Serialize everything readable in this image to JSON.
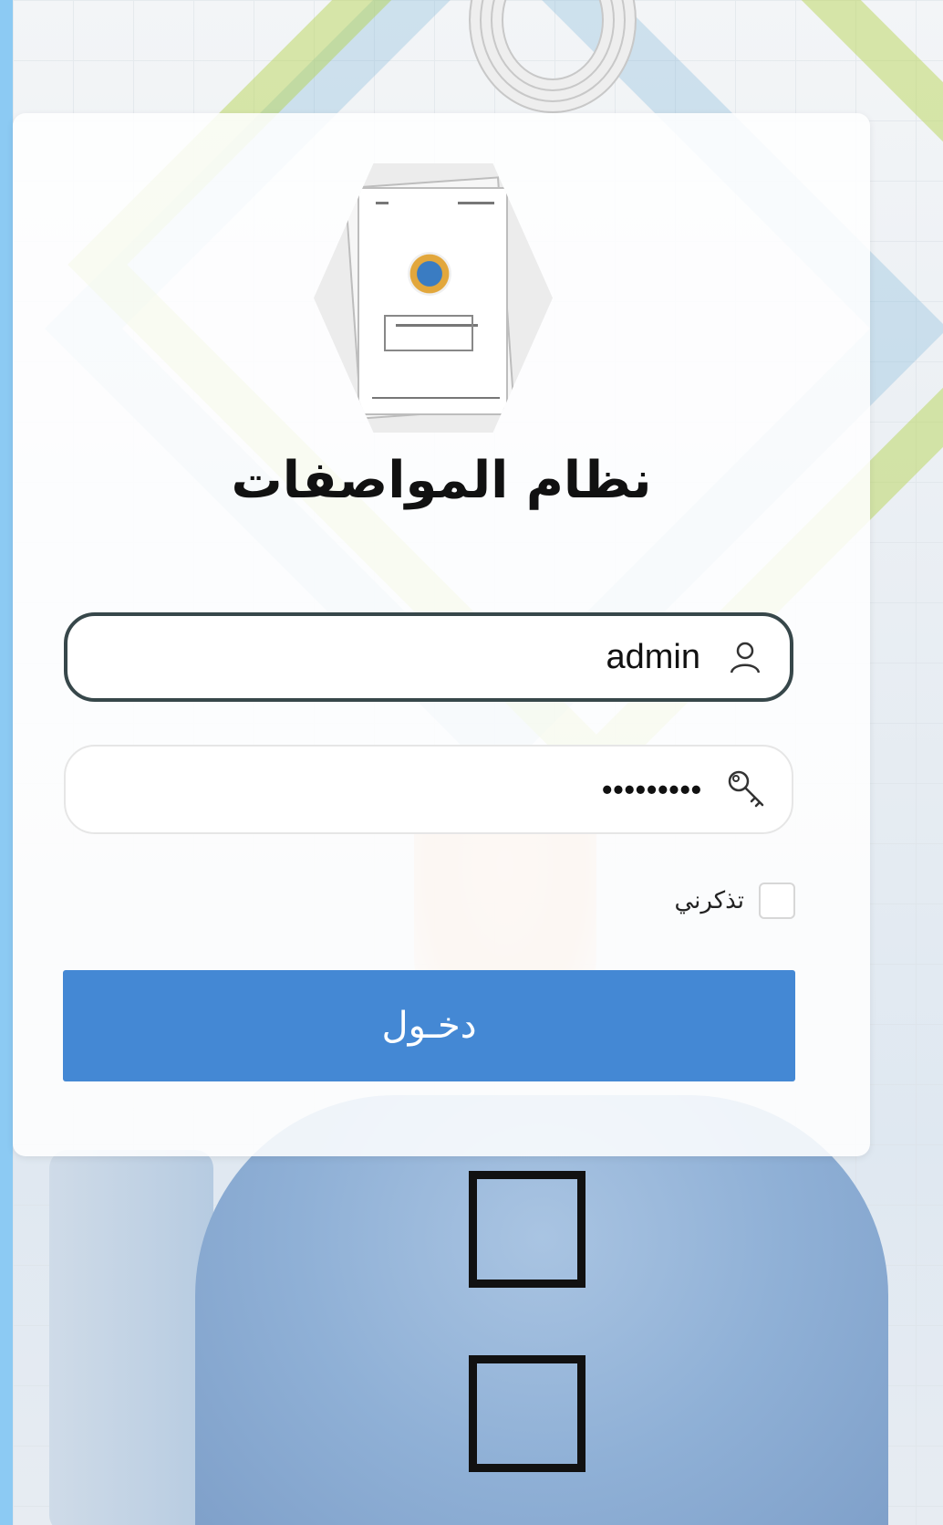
{
  "app": {
    "title": "نظام المواصفات"
  },
  "login": {
    "username_value": "admin",
    "password_mask": "•••••••••",
    "remember_label": "تذكرني",
    "submit_label": "دخـول"
  },
  "icons": {
    "username": "user-icon",
    "password": "key-icon"
  },
  "colors": {
    "accent_button": "#4488d4",
    "side_strip": "#8ccaf3"
  }
}
